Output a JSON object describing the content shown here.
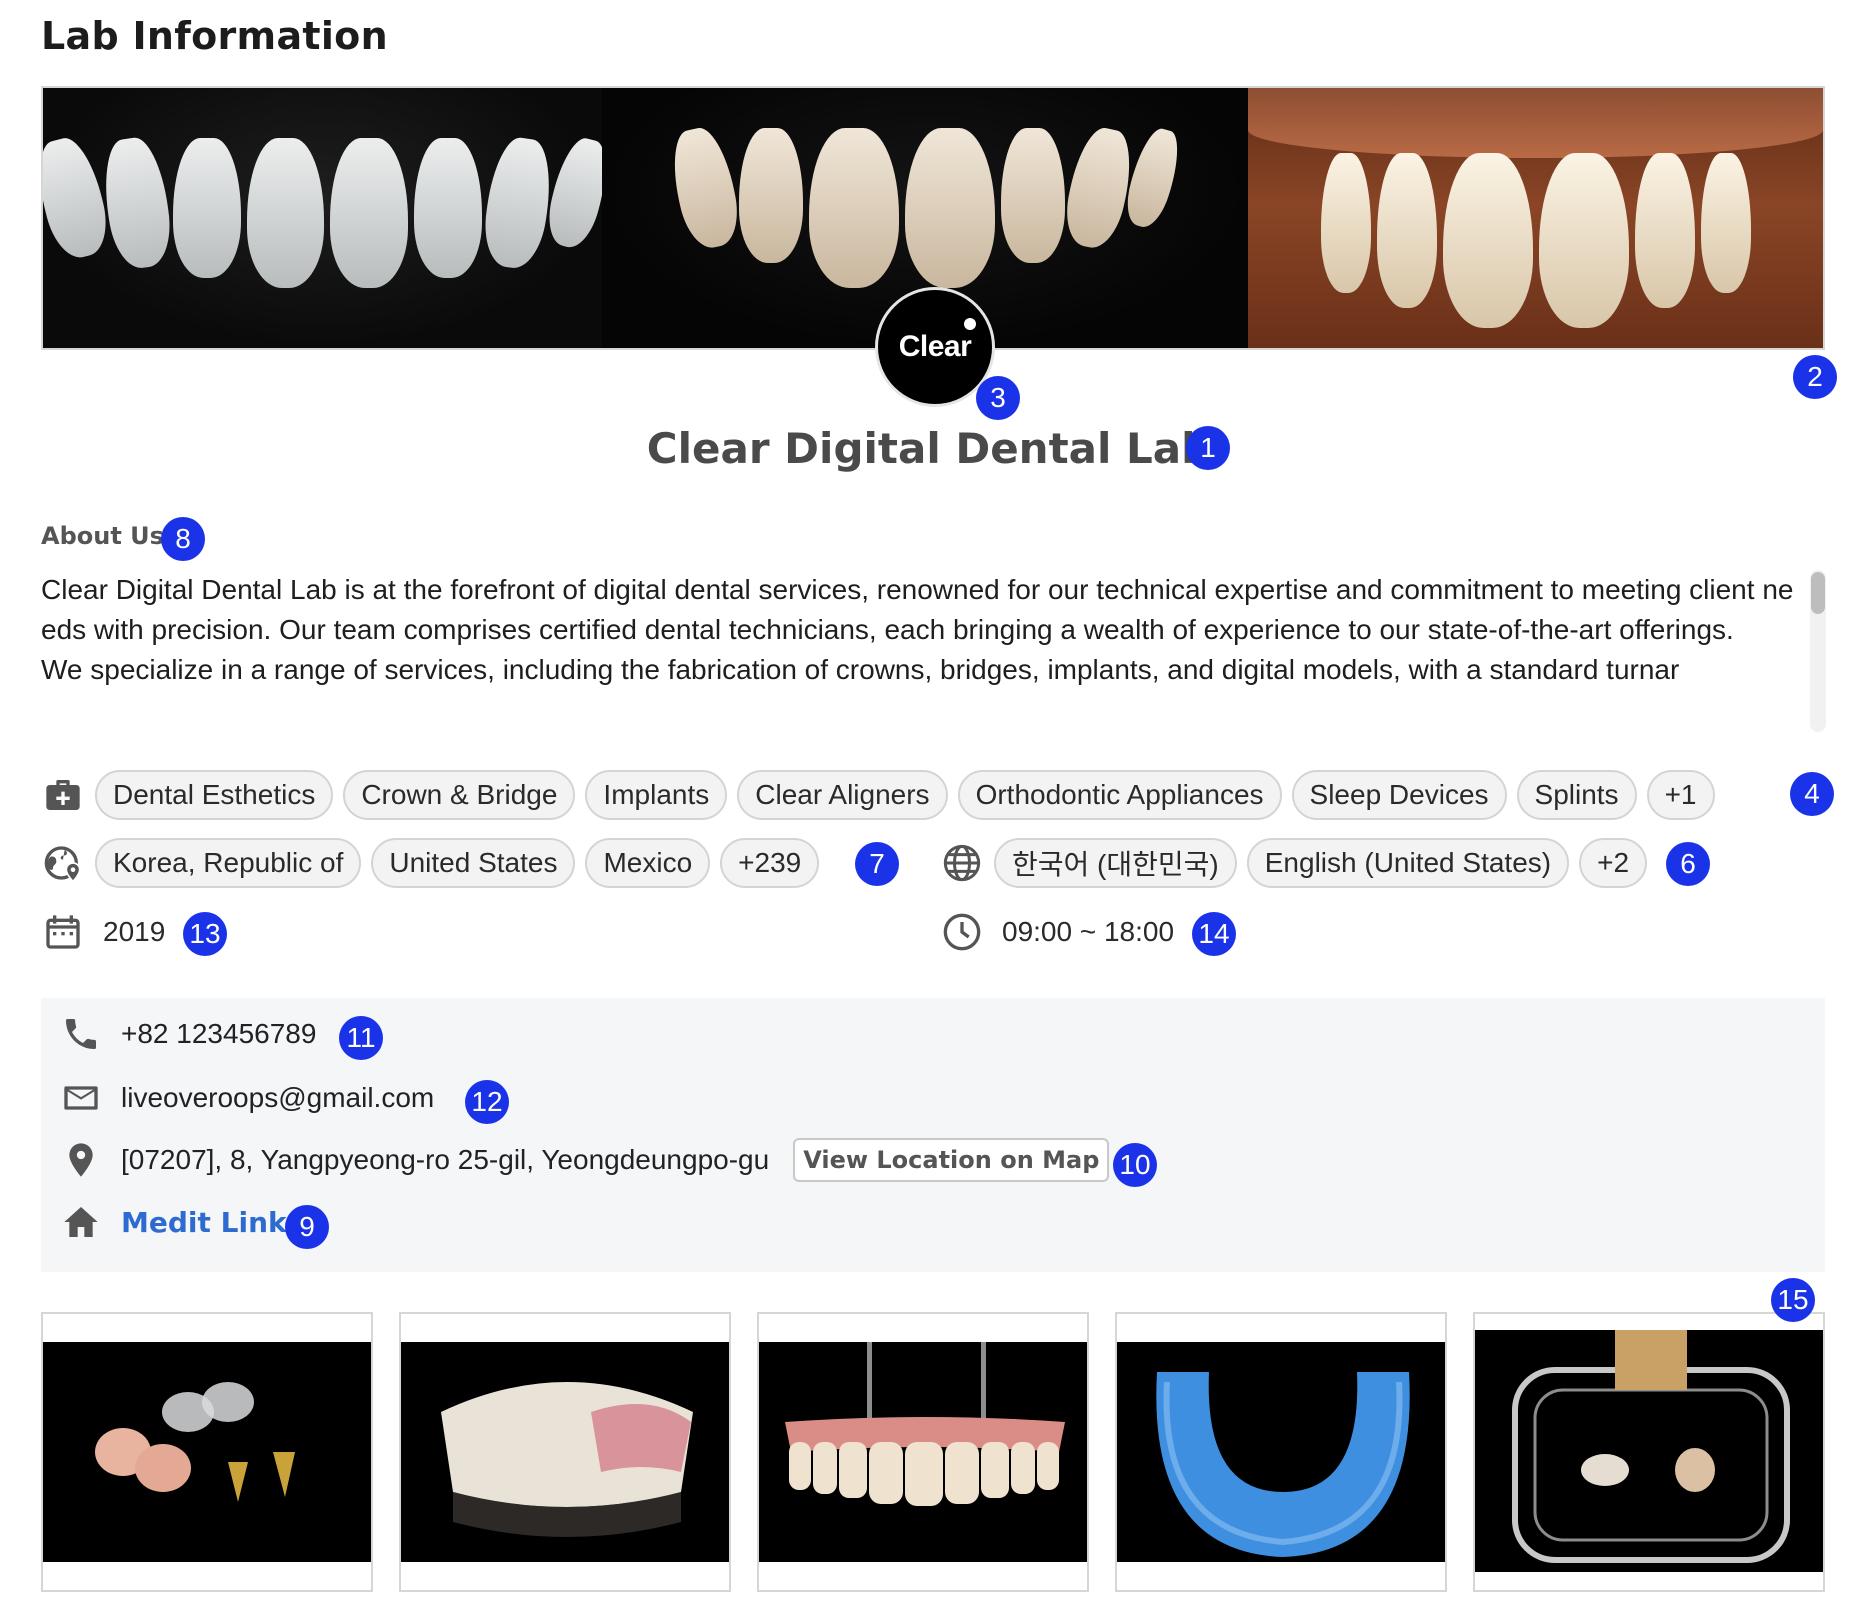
{
  "header": {
    "title": "Lab Information"
  },
  "logo": {
    "text": "Clear"
  },
  "lab": {
    "name": "Clear Digital Dental Lab"
  },
  "about": {
    "label": "About Us",
    "text": "Clear Digital Dental Lab is at the forefront of digital dental services, renowned for our technical expertise and commitment to meeting client needs with precision. Our team comprises certified dental technicians, each bringing a wealth of experience to our state-of-the-art offerings.\nWe specialize in a range of services, including the fabrication of crowns, bridges, implants, and digital models, with a standard turnar"
  },
  "services": {
    "icon": "medical-kit-icon",
    "items": [
      "Dental Esthetics",
      "Crown & Bridge",
      "Implants",
      "Clear Aligners",
      "Orthodontic Appliances",
      "Sleep Devices",
      "Splints",
      "+1"
    ]
  },
  "countries": {
    "icon": "globe-location-icon",
    "items": [
      "Korea, Republic of",
      "United States",
      "Mexico",
      "+239"
    ]
  },
  "languages": {
    "icon": "globe-icon",
    "items": [
      "한국어 (대한민국)",
      "English (United States)",
      "+2"
    ]
  },
  "established": {
    "icon": "calendar-icon",
    "year": "2019"
  },
  "hours": {
    "icon": "clock-icon",
    "value": "09:00 ~ 18:00"
  },
  "contact": {
    "phone": "+82 123456789",
    "email": "liveoveroops@gmail.com",
    "address": "[07207], 8, Yangpyeong-ro 25-gil, Yeongdeungpo-gu",
    "map_button": "View Location on Map",
    "website_label": "Medit Link"
  },
  "badges": {
    "b1": "1",
    "b2": "2",
    "b3": "3",
    "b4": "4",
    "b6": "6",
    "b7": "7",
    "b8": "8",
    "b9": "9",
    "b10": "10",
    "b11": "11",
    "b12": "12",
    "b13": "13",
    "b14": "14",
    "b15": "15"
  },
  "colors": {
    "badge": "#1b33e8",
    "link": "#2e6bd1",
    "contact_bg": "#f5f6f8"
  }
}
